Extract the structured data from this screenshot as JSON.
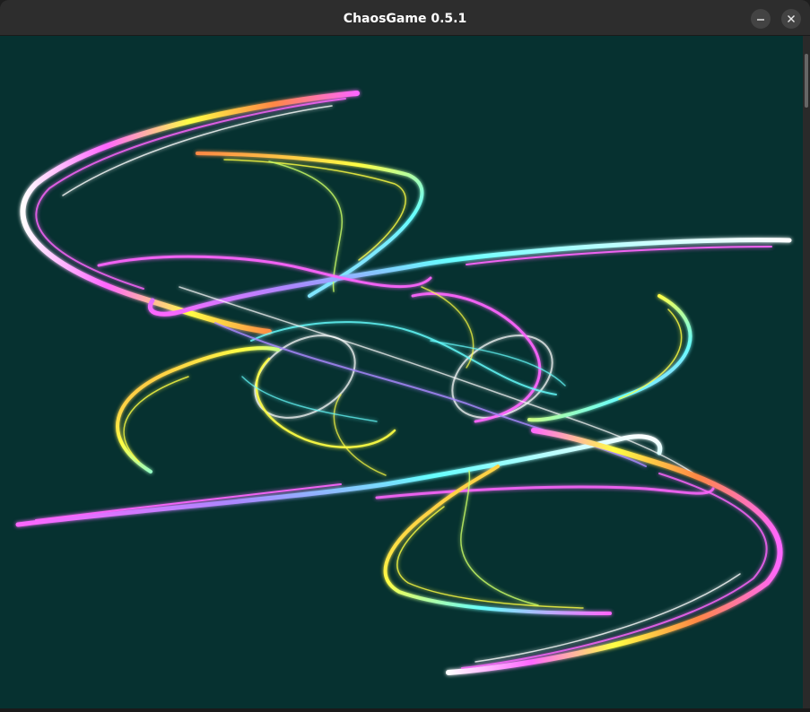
{
  "window": {
    "title": "ChaosGame 0.5.1",
    "minimize_icon": "minimize-icon",
    "close_icon": "close-icon"
  },
  "canvas": {
    "background_color": "#063130",
    "palette": [
      "#ffffff",
      "#ff66ff",
      "#ffff44",
      "#ff8844",
      "#66ffff",
      "#aa88ff"
    ]
  }
}
